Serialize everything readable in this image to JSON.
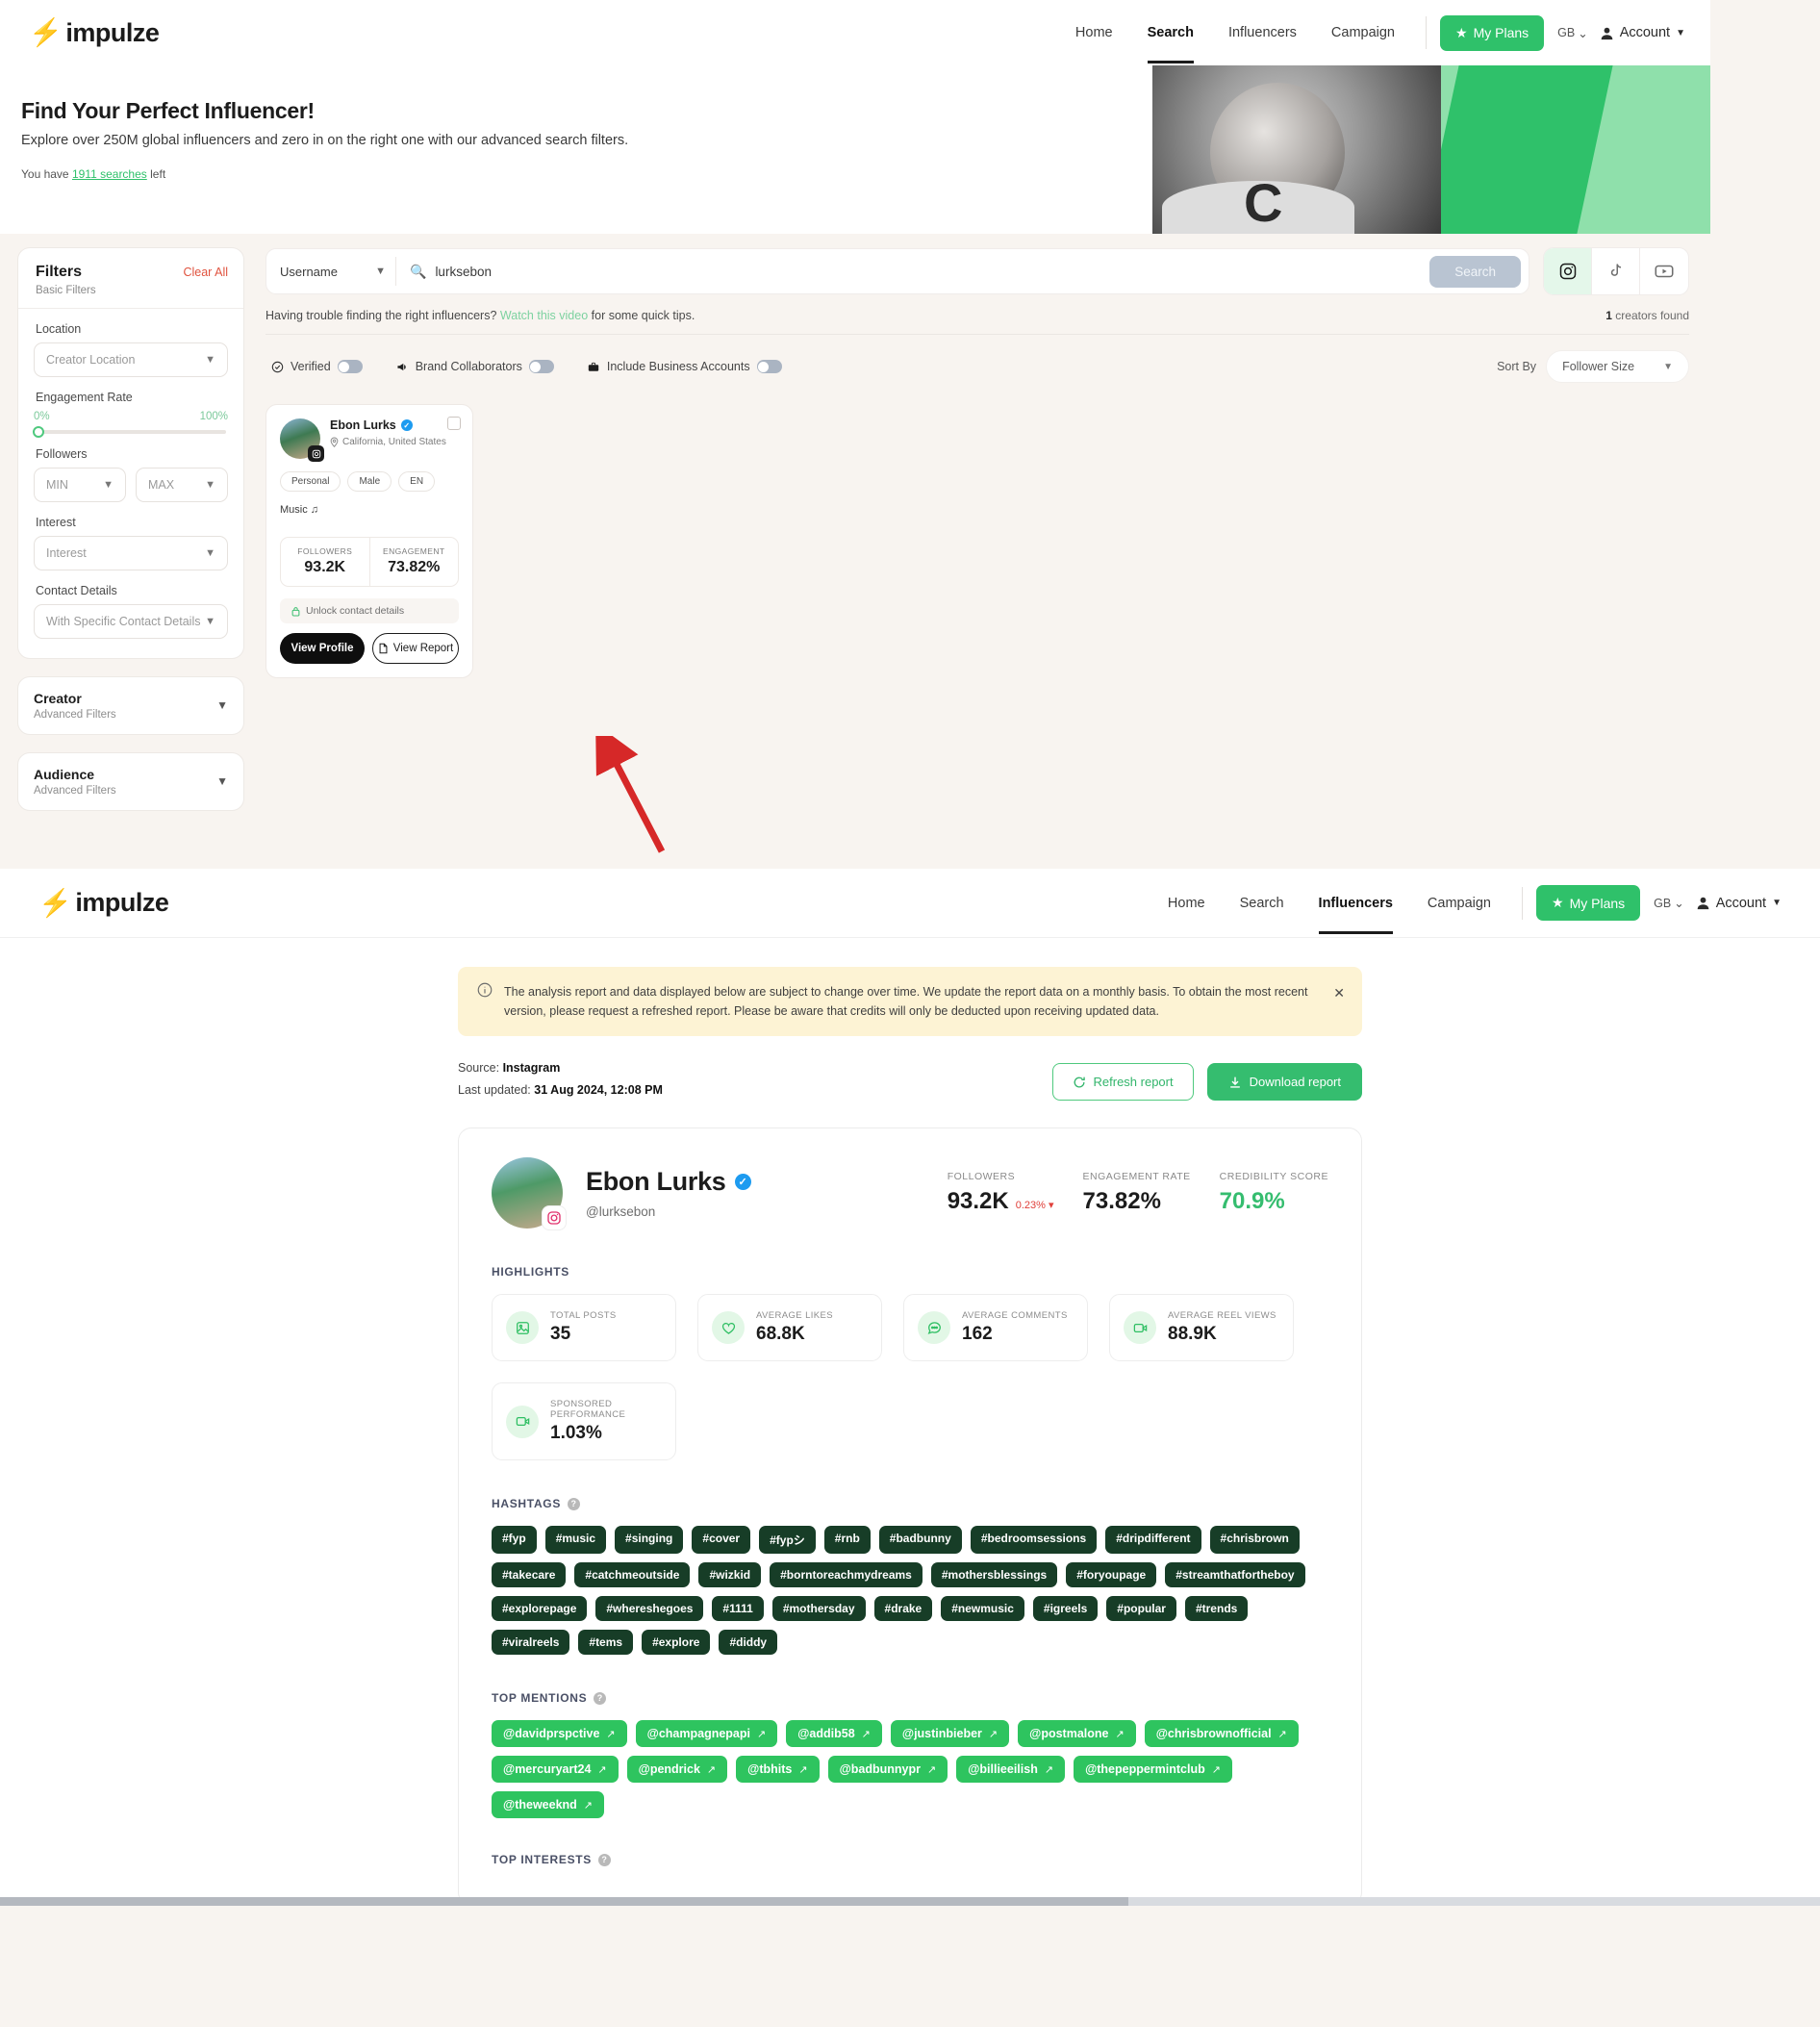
{
  "brand": {
    "name": "impulze",
    "accent": "#2fc16a"
  },
  "nav": {
    "items": [
      {
        "label": "Home"
      },
      {
        "label": "Search"
      },
      {
        "label": "Influencers"
      },
      {
        "label": "Campaign"
      }
    ],
    "plans_label": "My Plans",
    "geo": "GB",
    "account": "Account"
  },
  "hero": {
    "title": "Find Your Perfect Influencer!",
    "subtitle": "Explore over 250M global influencers and zero in on the right one with our advanced search filters.",
    "searches_prefix": "You have",
    "searches_link": "1911 searches",
    "searches_suffix": "left",
    "photo_letter": "C"
  },
  "filters": {
    "title": "Filters",
    "subtitle": "Basic Filters",
    "clear_all": "Clear All",
    "location_label": "Location",
    "location_placeholder": "Creator Location",
    "engagement_label": "Engagement Rate",
    "engagement_min": "0%",
    "engagement_max": "100%",
    "followers_label": "Followers",
    "followers_min": "MIN",
    "followers_max": "MAX",
    "interest_label": "Interest",
    "interest_placeholder": "Interest",
    "contact_label": "Contact Details",
    "contact_placeholder": "With Specific Contact Details",
    "creator_title": "Creator",
    "creator_sub": "Advanced Filters",
    "audience_title": "Audience",
    "audience_sub": "Advanced Filters"
  },
  "search": {
    "type_value": "Username",
    "query_value": "lurksebon",
    "button_label": "Search",
    "platforms": [
      {
        "name": "instagram",
        "active": true
      },
      {
        "name": "tiktok",
        "active": false
      },
      {
        "name": "youtube",
        "active": false
      }
    ],
    "help_prefix": "Having trouble finding the right influencers?",
    "help_link": "Watch this video",
    "help_suffix": "for some quick tips.",
    "creators_found_count": "1",
    "creators_found_label": "creators found",
    "toggles": [
      {
        "label": "Verified",
        "icon": "verified-icon",
        "on": false
      },
      {
        "label": "Brand Collaborators",
        "icon": "megaphone-icon",
        "on": false
      },
      {
        "label": "Include Business Accounts",
        "icon": "briefcase-icon",
        "on": false
      }
    ],
    "sort_by_label": "Sort By",
    "sort_by_value": "Follower Size"
  },
  "creator_card": {
    "name": "Ebon Lurks",
    "location": "California, United States",
    "tags": [
      "Personal",
      "Male",
      "EN"
    ],
    "category": "Music",
    "category_icon": "♫",
    "stats": [
      {
        "label": "FOLLOWERS",
        "value": "93.2K"
      },
      {
        "label": "ENGAGEMENT",
        "value": "73.82%"
      }
    ],
    "unlock_label": "Unlock contact details",
    "view_profile_label": "View Profile",
    "view_report_label": "View Report"
  },
  "report": {
    "notice": "The analysis report and data displayed below are subject to change over time. We update the report data on a monthly basis. To obtain the most recent version, please request a refreshed report. Please be aware that credits will only be deducted upon receiving updated data.",
    "source_label": "Source:",
    "source_value": "Instagram",
    "updated_label": "Last updated:",
    "updated_value": "31 Aug 2024, 12:08 PM",
    "refresh_label": "Refresh report",
    "download_label": "Download report",
    "profile": {
      "name": "Ebon Lurks",
      "handle": "@lurksebon",
      "stats": [
        {
          "label": "FOLLOWERS",
          "value": "93.2K",
          "delta": "0.23% ▾",
          "green": false
        },
        {
          "label": "ENGAGEMENT RATE",
          "value": "73.82%",
          "delta": "",
          "green": false
        },
        {
          "label": "CREDIBILITY SCORE",
          "value": "70.9%",
          "delta": "",
          "green": true
        }
      ]
    },
    "highlights_title": "HIGHLIGHTS",
    "highlights": [
      {
        "label": "TOTAL POSTS",
        "value": "35",
        "icon": "image-icon"
      },
      {
        "label": "AVERAGE LIKES",
        "value": "68.8K",
        "icon": "heart-icon"
      },
      {
        "label": "AVERAGE COMMENTS",
        "value": "162",
        "icon": "comment-icon"
      },
      {
        "label": "AVERAGE REEL VIEWS",
        "value": "88.9K",
        "icon": "video-icon"
      },
      {
        "label": "SPONSORED PERFORMANCE",
        "value": "1.03%",
        "icon": "video-icon"
      }
    ],
    "hashtags_title": "HASHTAGS",
    "hashtags": [
      "#fyp",
      "#music",
      "#singing",
      "#cover",
      "#fypシ",
      "#rnb",
      "#badbunny",
      "#bedroomsessions",
      "#dripdifferent",
      "#chrisbrown",
      "#takecare",
      "#catchmeoutside",
      "#wizkid",
      "#borntoreachmydreams",
      "#mothersblessings",
      "#foryoupage",
      "#streamthatfortheboy",
      "#explorepage",
      "#whereshegoes",
      "#1111",
      "#mothersday",
      "#drake",
      "#newmusic",
      "#igreels",
      "#popular",
      "#trends",
      "#viralreels",
      "#tems",
      "#explore",
      "#diddy"
    ],
    "mentions_title": "TOP MENTIONS",
    "mentions": [
      "@davidprspctive",
      "@champagnepapi",
      "@addib58",
      "@justinbieber",
      "@postmalone",
      "@chrisbrownofficial",
      "@mercuryart24",
      "@pendrick",
      "@tbhits",
      "@badbunnypr",
      "@billieeilish",
      "@thepeppermintclub",
      "@theweeknd"
    ],
    "interests_title": "TOP INTERESTS"
  }
}
